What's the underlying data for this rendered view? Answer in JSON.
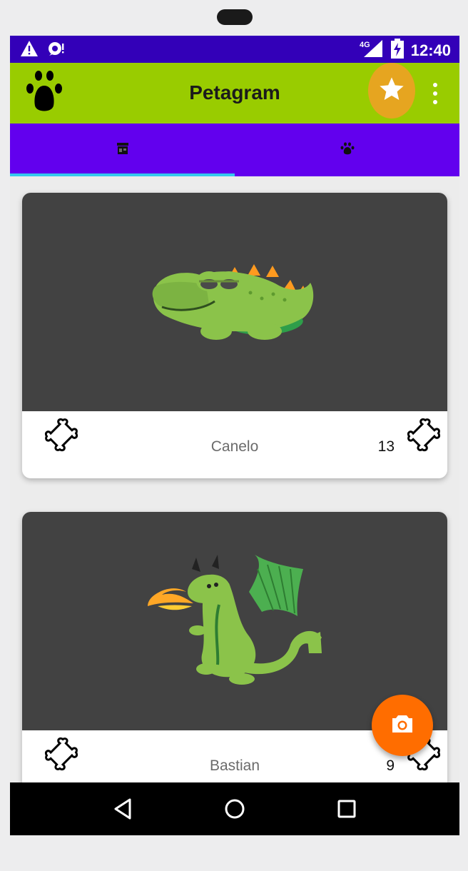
{
  "statusbar": {
    "time": "12:40",
    "network": "4G",
    "icons": [
      "warning-icon",
      "sync-alert-icon",
      "signal-icon",
      "battery-charging-icon"
    ]
  },
  "appbar": {
    "title": "Petagram",
    "logo_icon": "paw-icon",
    "favorite_icon": "star-icon",
    "menu_icon": "overflow-menu-icon",
    "colors": {
      "background": "#99cc00",
      "star_button": "#e6a520"
    }
  },
  "tabs": {
    "items": [
      {
        "icon": "store-icon",
        "selected": true
      },
      {
        "icon": "paw-icon",
        "selected": false
      }
    ],
    "colors": {
      "background": "#6200ee",
      "indicator": "#35c8ee"
    }
  },
  "pets": [
    {
      "name": "Canelo",
      "likes": "13",
      "image": "crocodile-illustration"
    },
    {
      "name": "Bastian",
      "likes": "9",
      "image": "dragon-illustration"
    }
  ],
  "fab": {
    "icon": "camera-icon",
    "color": "#ff6d00"
  },
  "navbar": {
    "icons": [
      "back-icon",
      "home-icon",
      "recents-icon"
    ]
  }
}
